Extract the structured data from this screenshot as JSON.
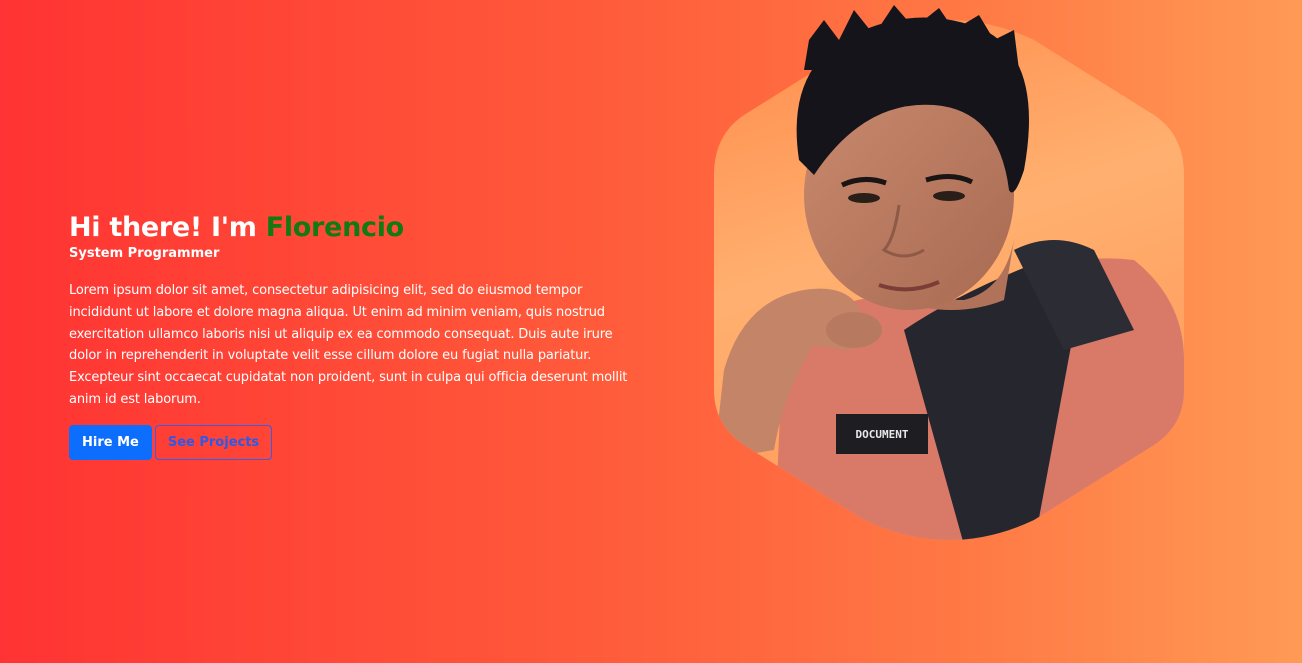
{
  "hero": {
    "greeting": "Hi there! I'm ",
    "name": "Florencio",
    "subtitle": "System Programmer",
    "description": "Lorem ipsum dolor sit amet, consectetur adipisicing elit, sed do eiusmod tempor incididunt ut labore et dolore magna aliqua. Ut enim ad minim veniam, quis nostrud exercitation ullamco laboris nisi ut aliquip ex ea commodo consequat. Duis aute irure dolor in reprehenderit in voluptate velit esse cillum dolore eu fugiat nulla pariatur. Excepteur sint occaecat cupidatat non proident, sunt in culpa qui officia deserunt mollit anim id est laborum.",
    "buttons": {
      "hire": "Hire Me",
      "projects": "See Projects"
    }
  },
  "portrait": {
    "jacket_text": "DOCUMENT"
  },
  "colors": {
    "name_accent": "#127a12",
    "primary_button": "#0d6efd",
    "outline_button": "#3a5ce6",
    "bg_left": "#ff3333",
    "bg_right": "#ff9a55"
  }
}
